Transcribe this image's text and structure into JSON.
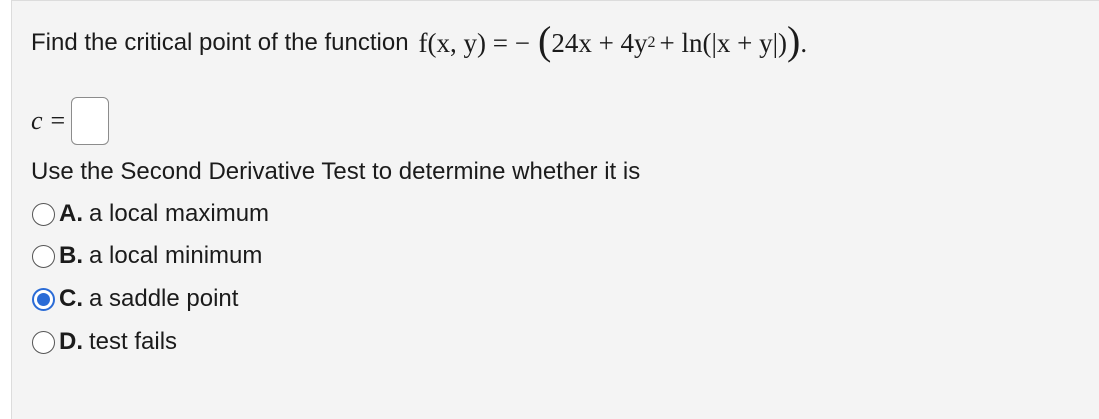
{
  "question": {
    "prompt": "Find the critical point of the function",
    "function_lhs": "f(x, y) = −",
    "function_open": "(",
    "function_body": "24x + 4y",
    "exponent": "2",
    "function_tail": " + ln(|x + y|)",
    "function_close": ")",
    "period": "."
  },
  "answer": {
    "label": "c",
    "equals": "=",
    "value": ""
  },
  "instruction": "Use the Second Derivative Test to determine whether it is",
  "options": [
    {
      "letter": "A.",
      "text": "a local maximum",
      "selected": false
    },
    {
      "letter": "B.",
      "text": "a local minimum",
      "selected": false
    },
    {
      "letter": "C.",
      "text": "a saddle point",
      "selected": true
    },
    {
      "letter": "D.",
      "text": "test fails",
      "selected": false
    }
  ],
  "colors": {
    "accent": "#2a6bd6",
    "panel_background": "#f4f4f4"
  }
}
